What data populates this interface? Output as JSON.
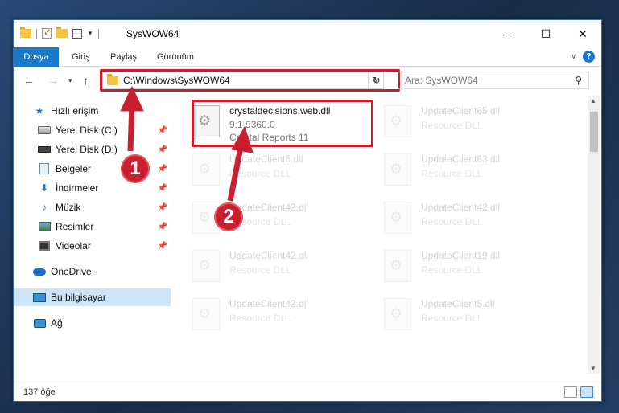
{
  "window": {
    "title": "SysWOW64",
    "controls": {
      "minimize": "—",
      "maximize": "☐",
      "close": "✕"
    }
  },
  "ribbon": {
    "tabs": [
      "Dosya",
      "Giriş",
      "Paylaş",
      "Görünüm"
    ],
    "help": "?"
  },
  "address_bar": {
    "path": "C:\\Windows\\SysWOW64",
    "search_placeholder": "Ara: SysWOW64"
  },
  "navigation": {
    "quick_access": "Hızlı erişim",
    "items": [
      {
        "label": "Yerel Disk (C:)",
        "icon": "drive-icon",
        "pinned": true
      },
      {
        "label": "Yerel Disk (D:)",
        "icon": "drive-icon",
        "pinned": true
      },
      {
        "label": "Belgeler",
        "icon": "documents-icon",
        "pinned": true
      },
      {
        "label": "İndirmeler",
        "icon": "downloads-icon",
        "pinned": true
      },
      {
        "label": "Müzik",
        "icon": "music-icon",
        "pinned": true
      },
      {
        "label": "Resimler",
        "icon": "pictures-icon",
        "pinned": true
      },
      {
        "label": "Videolar",
        "icon": "videos-icon",
        "pinned": true
      }
    ],
    "onedrive": "OneDrive",
    "this_pc": "Bu bilgisayar",
    "network": "Ağ"
  },
  "files": [
    {
      "name": "crystaldecisions.web.dll",
      "line1": "9.1.9360.0",
      "line2": "Crystal Reports 11",
      "highlight": true
    },
    {
      "name": "UpdateClient65.dll",
      "line1": "Resource DLL"
    },
    {
      "name": "UpdateClient5.dll",
      "line1": "Resource DLL"
    },
    {
      "name": "UpdateClient63.dll",
      "line1": "Resource DLL"
    },
    {
      "name": "UpdateClient42.dll",
      "line1": "Resource DLL"
    },
    {
      "name": "UpdateClient42.dll",
      "line1": "Resource DLL"
    },
    {
      "name": "UpdateClient42.dll",
      "line1": "Resource DLL"
    },
    {
      "name": "UpdateClient19.dll",
      "line1": "Resource DLL"
    },
    {
      "name": "UpdateClient42.dll",
      "line1": "Resource DLL"
    },
    {
      "name": "UpdateClient5.dll",
      "line1": "Resource DLL"
    }
  ],
  "status": {
    "count": "137 öğe"
  },
  "annotations": {
    "badge1": "1",
    "badge2": "2"
  },
  "colors": {
    "accent": "#1979ca",
    "highlight": "#c8202f",
    "selected": "#cce4f7"
  }
}
